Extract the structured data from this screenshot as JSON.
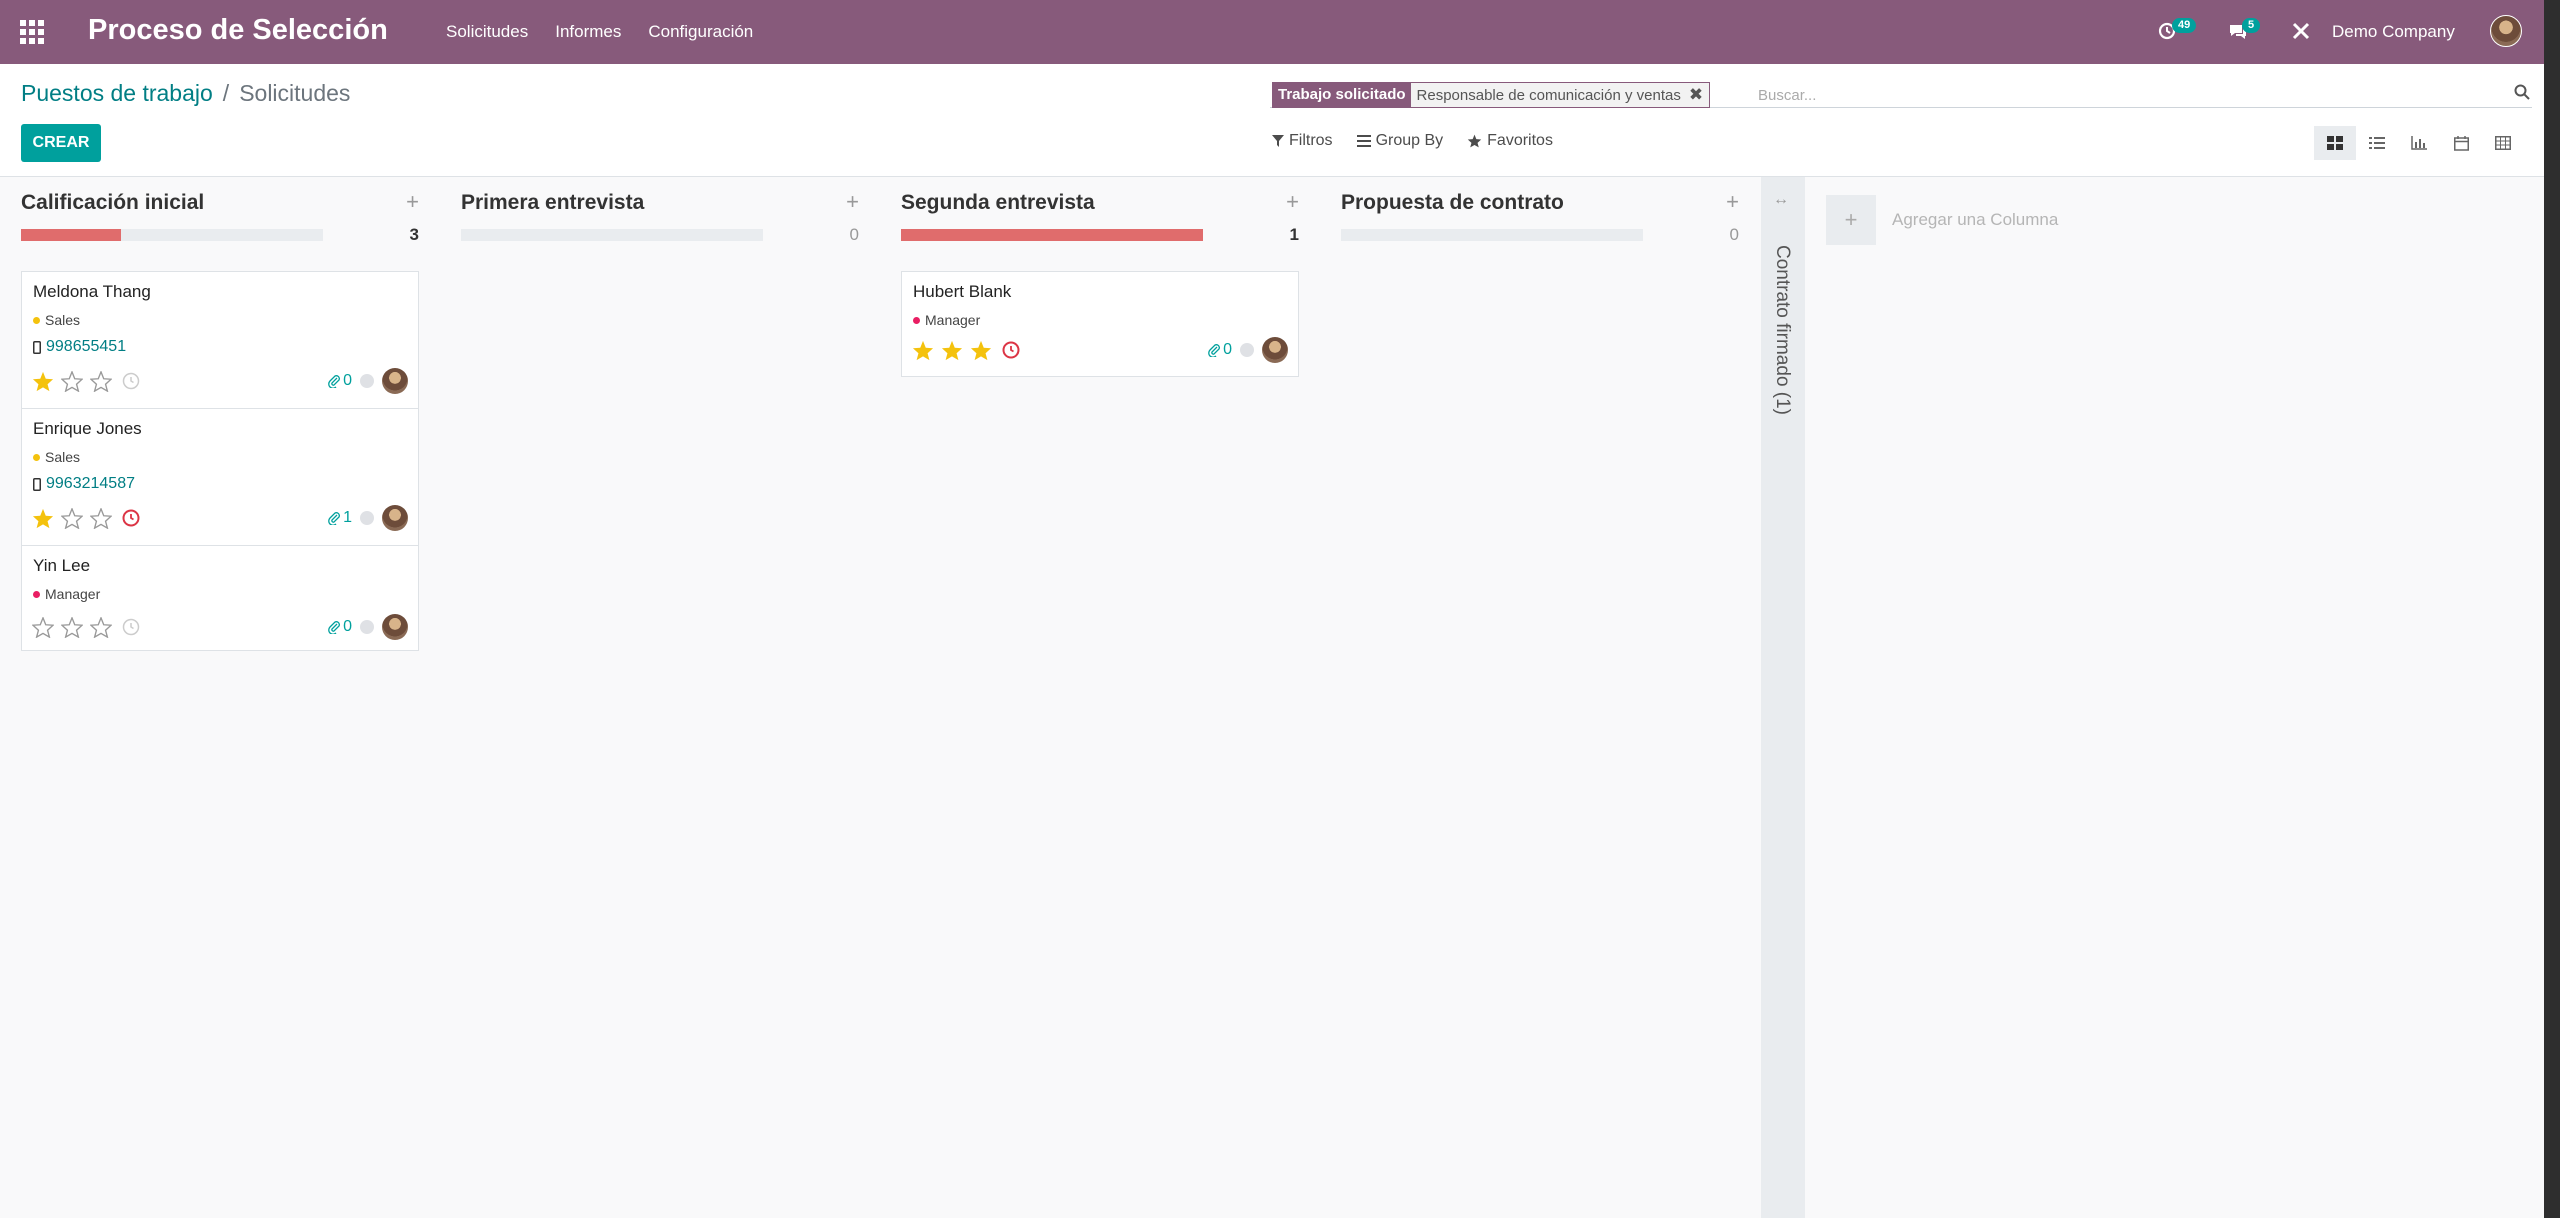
{
  "navbar": {
    "brand": "Proceso de Selección",
    "menu": [
      "Solicitudes",
      "Informes",
      "Configuración"
    ],
    "activity_count": "49",
    "message_count": "5",
    "company": "Demo Company"
  },
  "breadcrumb": {
    "parent": "Puestos de trabajo",
    "separator": "/",
    "current": "Solicitudes"
  },
  "create_label": "CREAR",
  "search": {
    "facet_category": "Trabajo solicitado",
    "facet_value": "Responsable de comunicación y ventas",
    "placeholder": "Buscar..."
  },
  "filters": {
    "filters_label": "Filtros",
    "group_by_label": "Group By",
    "favorites_label": "Favoritos"
  },
  "views": [
    "kanban",
    "list",
    "graph",
    "calendar",
    "pivot"
  ],
  "colors": {
    "navbar": "#875a7b",
    "primary": "#00a09d",
    "progress_red": "#e06c6c",
    "tag_sales": "#f4c20d",
    "tag_manager": "#e91e63"
  },
  "columns": [
    {
      "title": "Calificación inicial",
      "count": "3",
      "progress_fraction": 0.33,
      "cards": [
        {
          "name": "Meldona Thang",
          "tag": "Sales",
          "tag_color": "#f4c20d",
          "phone": "998655451",
          "stars": 1,
          "activity": "none",
          "attachments": "0"
        },
        {
          "name": "Enrique Jones",
          "tag": "Sales",
          "tag_color": "#f4c20d",
          "phone": "9963214587",
          "stars": 1,
          "activity": "overdue",
          "attachments": "1"
        },
        {
          "name": "Yin Lee",
          "tag": "Manager",
          "tag_color": "#e91e63",
          "phone": "",
          "stars": 0,
          "activity": "none",
          "attachments": "0"
        }
      ]
    },
    {
      "title": "Primera entrevista",
      "count": "0",
      "progress_fraction": 0,
      "cards": []
    },
    {
      "title": "Segunda entrevista",
      "count": "1",
      "progress_fraction": 1,
      "cards": [
        {
          "name": "Hubert Blank",
          "tag": "Manager",
          "tag_color": "#e91e63",
          "phone": "",
          "stars": 3,
          "activity": "overdue",
          "attachments": "0"
        }
      ]
    },
    {
      "title": "Propuesta de contrato",
      "count": "0",
      "progress_fraction": 0,
      "cards": []
    }
  ],
  "folded_column": "Contrato firmado (1)",
  "add_column_label": "Agregar una Columna"
}
